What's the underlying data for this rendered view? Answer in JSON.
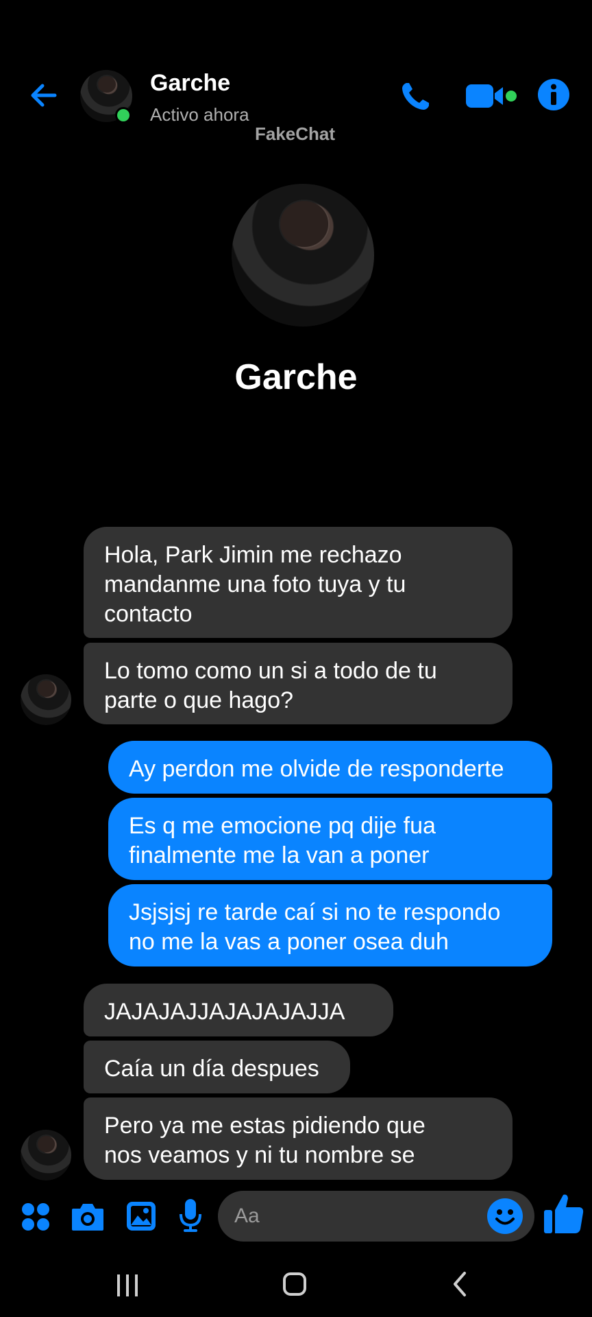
{
  "header": {
    "title": "Garche",
    "status": "Activo ahora",
    "watermark": "FakeChat",
    "accent_color": "#0a84ff",
    "online_color": "#31d05a",
    "icons": [
      "back-arrow-icon",
      "phone-icon",
      "video-icon",
      "info-icon"
    ]
  },
  "profile": {
    "name": "Garche"
  },
  "messages": [
    {
      "side": "in",
      "text": "Hola, Park Jimin me rechazo\nmandanme una foto tuya y tu\ncontacto"
    },
    {
      "side": "in",
      "text": "Lo tomo como un si a todo de tu\nparte o que hago?"
    },
    {
      "side": "out",
      "text": "Ay perdon me olvide de responderte"
    },
    {
      "side": "out",
      "text": "Es q me emocione pq dije fua\nfinalmente me la van a poner"
    },
    {
      "side": "out",
      "text": "Jsjsjsj re tarde caí si no te respondo\nno me la vas a poner osea duh"
    },
    {
      "side": "in",
      "text": "JAJAJAJJAJAJAJAJJA"
    },
    {
      "side": "in",
      "text": "Caía un día despues"
    },
    {
      "side": "in",
      "text": "Pero ya me estas pidiendo que\nnos veamos y ni tu nombre se"
    }
  ],
  "composer": {
    "placeholder": "Aa",
    "icons": [
      "apps-icon",
      "camera-icon",
      "gallery-icon",
      "mic-icon",
      "emoji-icon",
      "thumbs-up-icon"
    ]
  },
  "nav": {
    "icons": [
      "recents-icon",
      "home-icon",
      "back-icon"
    ]
  }
}
